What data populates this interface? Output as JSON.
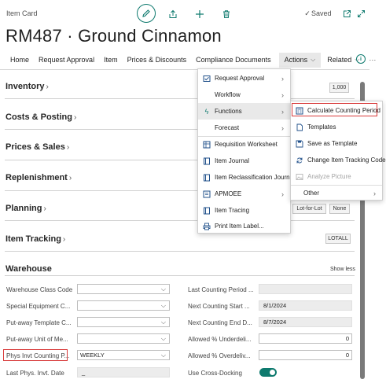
{
  "page": {
    "breadcrumb": "Item Card",
    "title": "RM487 · Ground Cinnamon",
    "saved_status": "Saved"
  },
  "nav": {
    "items": [
      "Home",
      "Request Approval",
      "Item",
      "Prices & Discounts",
      "Compliance Documents"
    ],
    "actions": "Actions",
    "related": "Related",
    "more": "···"
  },
  "sections": {
    "inventory": {
      "title": "Inventory",
      "chip": "1,000"
    },
    "costs": {
      "title": "Costs & Posting"
    },
    "prices": {
      "title": "Prices & Sales"
    },
    "replenishment": {
      "title": "Replenishment"
    },
    "planning": {
      "title": "Planning",
      "chip1": "Lot-for-Lot",
      "chip2": "None"
    },
    "tracking": {
      "title": "Item Tracking",
      "chip": "LOTALL"
    },
    "warehouse": {
      "title": "Warehouse",
      "show_less": "Show less"
    }
  },
  "warehouse": {
    "left": [
      {
        "label": "Warehouse Class Code",
        "value": ""
      },
      {
        "label": "Special Equipment C...",
        "value": ""
      },
      {
        "label": "Put-away Template C...",
        "value": ""
      },
      {
        "label": "Put-away Unit of Me...",
        "value": ""
      },
      {
        "label": "Phys Invt Counting P...",
        "value": "WEEKLY"
      },
      {
        "label": "Last Phys. Invt. Date",
        "value": "_"
      }
    ],
    "right": [
      {
        "label": "Last Counting Period ...",
        "value": ""
      },
      {
        "label": "Next Counting Start ...",
        "value": "8/1/2024"
      },
      {
        "label": "Next Counting End D...",
        "value": "8/7/2024"
      },
      {
        "label": "Allowed % Underdeli...",
        "value": "0"
      },
      {
        "label": "Allowed % Overdeliv...",
        "value": "0"
      },
      {
        "label": "Use Cross-Docking",
        "value": "on"
      }
    ]
  },
  "actions_menu": {
    "items": [
      {
        "label": "Request Approval",
        "icon": "approval-icon",
        "submenu": true
      },
      {
        "label": "Workflow",
        "icon": "",
        "submenu": true
      },
      {
        "label": "Functions",
        "icon": "lightning-icon",
        "submenu": true
      },
      {
        "label": "Forecast",
        "icon": "",
        "submenu": true
      },
      {
        "label": "Requisition Worksheet",
        "icon": "worksheet-icon",
        "submenu": false
      },
      {
        "label": "Item Journal",
        "icon": "journal-icon",
        "submenu": false
      },
      {
        "label": "Item Reclassification Journal",
        "icon": "journal-icon",
        "submenu": false
      },
      {
        "label": "APMOEE",
        "icon": "list-icon",
        "submenu": true
      },
      {
        "label": "Item Tracing",
        "icon": "journal-icon",
        "submenu": false
      },
      {
        "label": "Print Item Label...",
        "icon": "print-icon",
        "submenu": false
      }
    ]
  },
  "functions_menu": {
    "items": [
      {
        "label": "Calculate Counting Period",
        "icon": "calculator-icon"
      },
      {
        "label": "Templates",
        "icon": "document-icon"
      },
      {
        "label": "Save as Template",
        "icon": "save-icon"
      },
      {
        "label": "Change Item Tracking Code",
        "icon": "refresh-icon"
      },
      {
        "label": "Analyze Picture",
        "icon": "picture-icon",
        "disabled": true
      },
      {
        "label": "Other",
        "icon": "",
        "submenu": true
      }
    ]
  },
  "colors": {
    "accent": "#0e7a6e",
    "highlight": "#d83b3b",
    "menu_icon": "#1f4f8a"
  }
}
